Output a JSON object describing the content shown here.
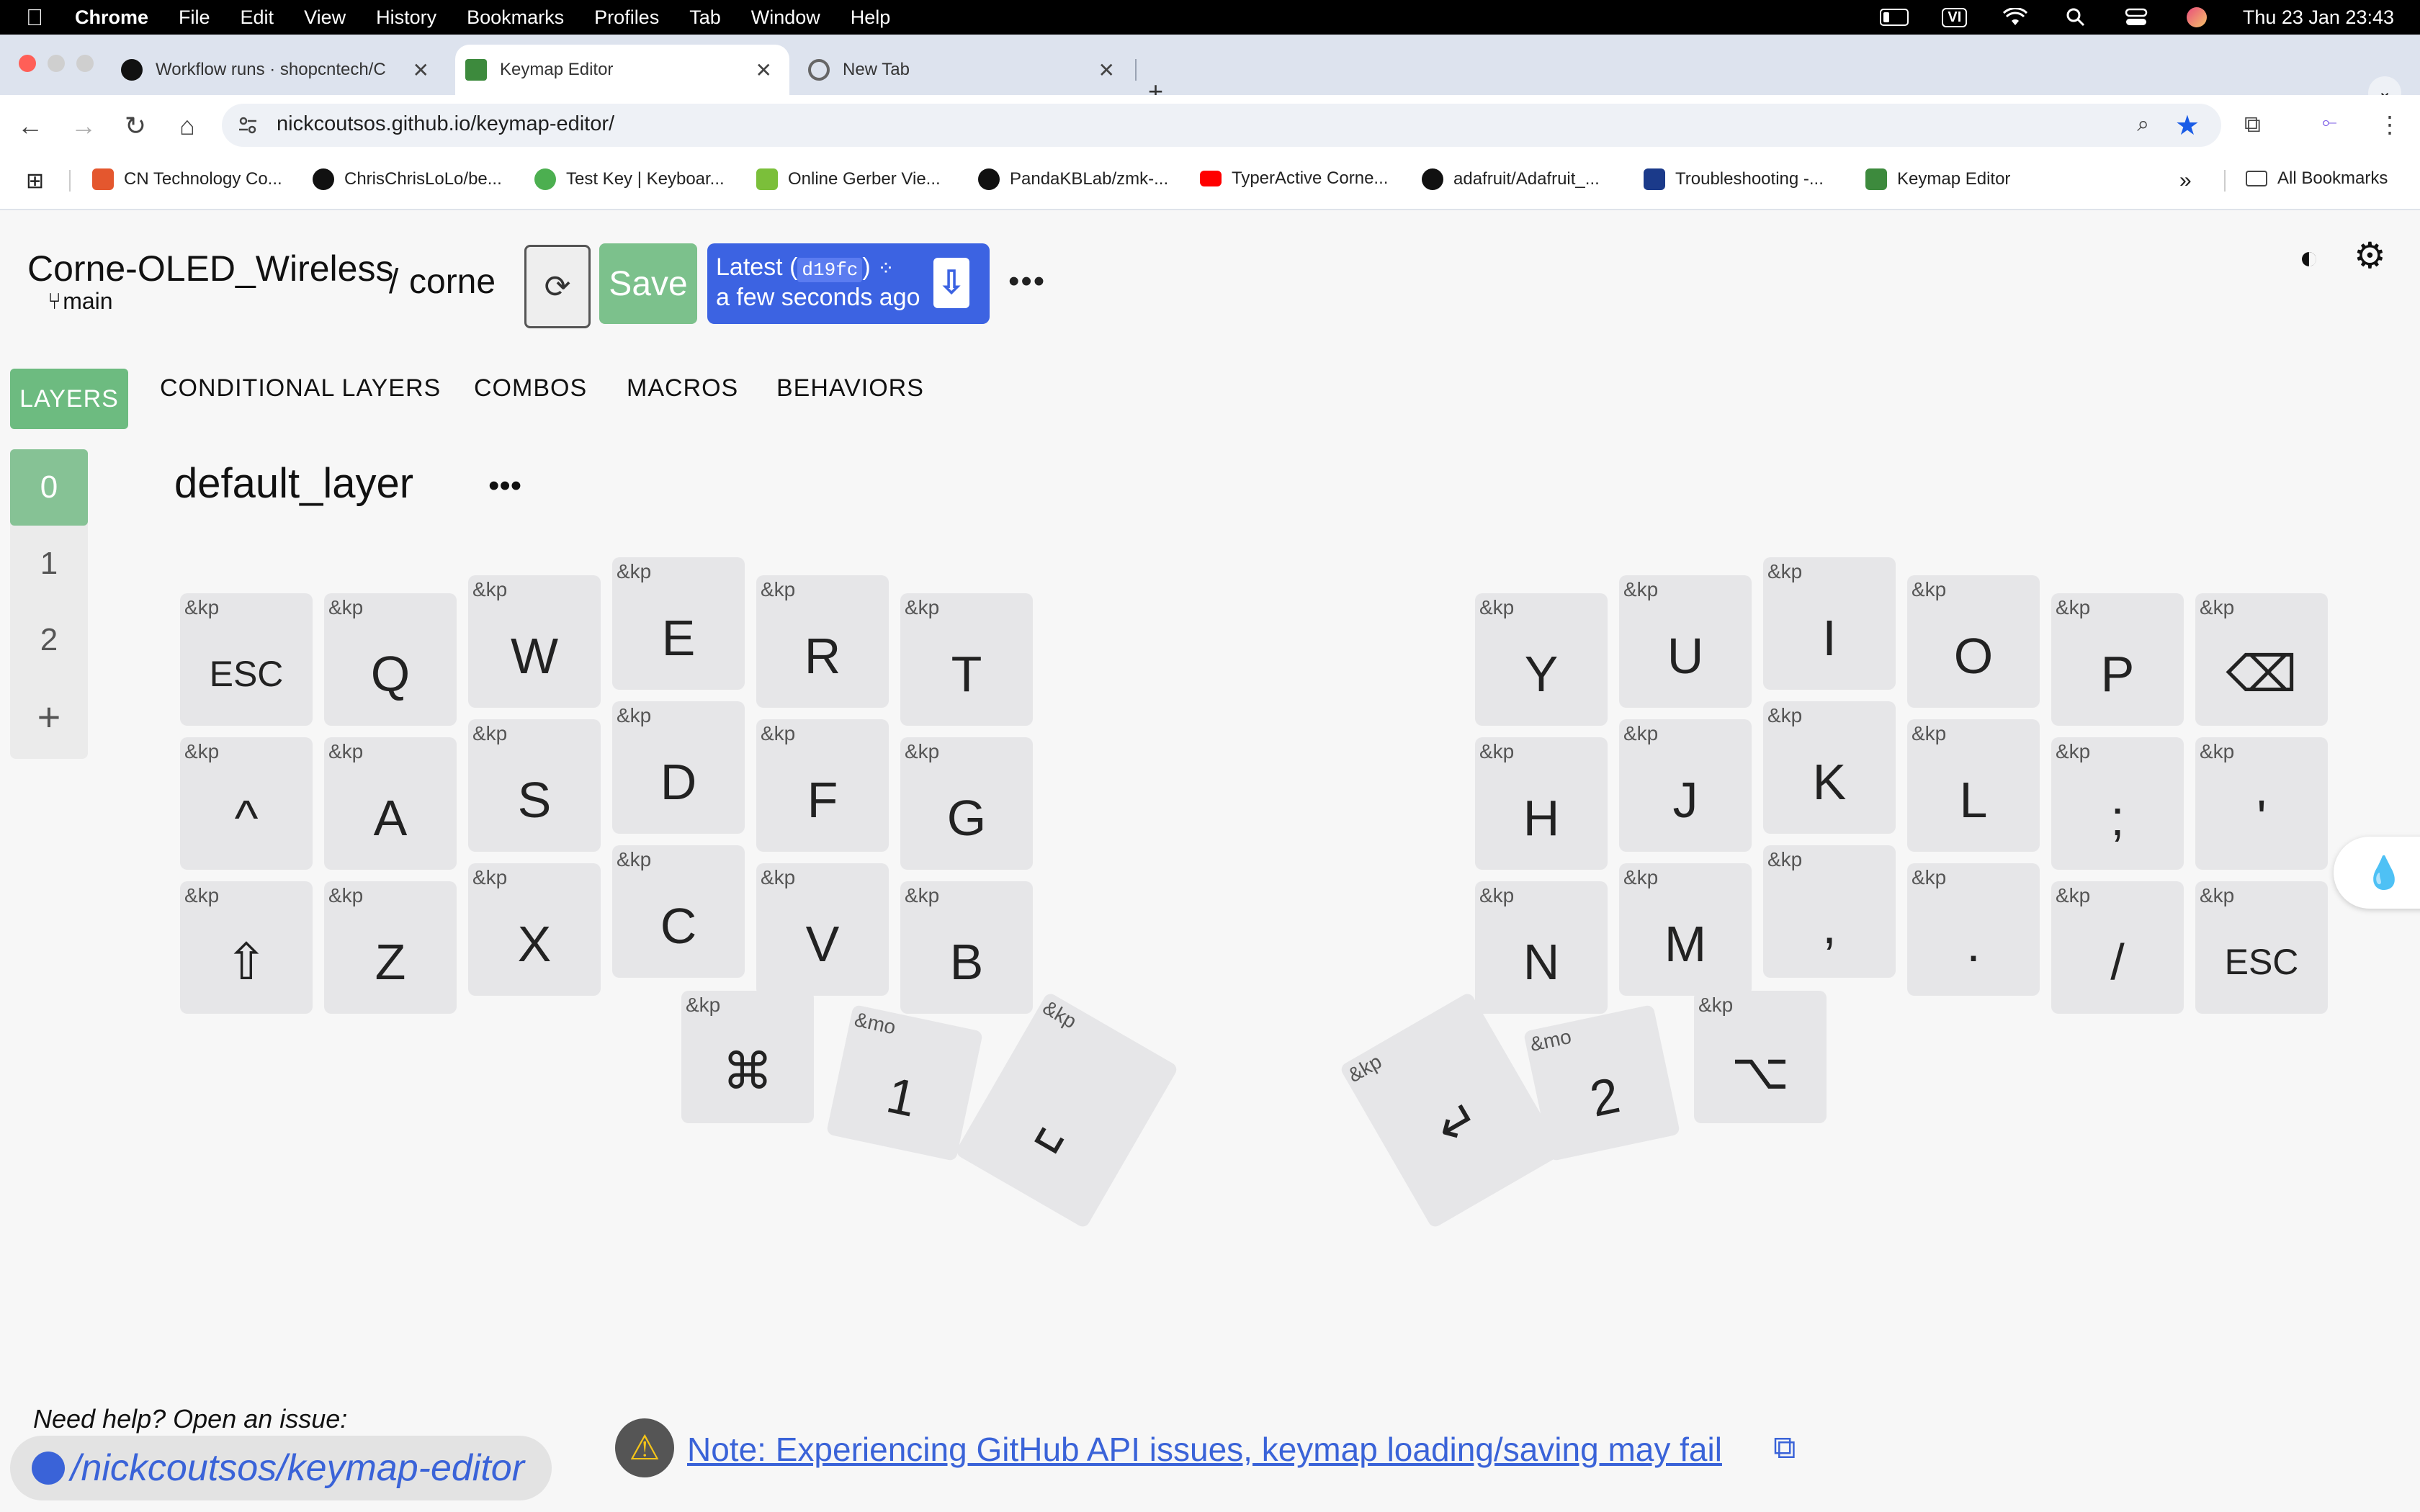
{
  "menubar": {
    "app": "Chrome",
    "items": [
      "File",
      "Edit",
      "View",
      "History",
      "Bookmarks",
      "Profiles",
      "Tab",
      "Window",
      "Help"
    ],
    "input_source": "VI",
    "clock": "Thu 23 Jan  23:43"
  },
  "tabs": [
    {
      "title": "Workflow runs · shopcntech/C",
      "icon": "github-icon"
    },
    {
      "title": "Keymap Editor",
      "icon": "keymap-editor-icon",
      "active": true
    },
    {
      "title": "New Tab",
      "icon": "chrome-icon"
    }
  ],
  "toolbar": {
    "url": "nickcoutsos.github.io/keymap-editor/"
  },
  "bookmarks": [
    {
      "label": "CN Technology Co...",
      "icon": "shop-icon",
      "color": "#e4572e"
    },
    {
      "label": "ChrisChrisLoLo/be...",
      "icon": "github-icon",
      "color": "#111111"
    },
    {
      "label": "Test Key | Keyboar...",
      "icon": "k-icon",
      "color": "#4caf50"
    },
    {
      "label": "Online Gerber Vie...",
      "icon": "gerber-icon",
      "color": "#7bbf3a"
    },
    {
      "label": "PandaKBLab/zmk-...",
      "icon": "github-icon",
      "color": "#111111"
    },
    {
      "label": "TyperActive Corne...",
      "icon": "youtube-icon",
      "color": "#ff0000"
    },
    {
      "label": "adafruit/Adafruit_...",
      "icon": "github-icon",
      "color": "#111111"
    },
    {
      "label": "Troubleshooting -...",
      "icon": "notion-icon",
      "color": "#1b3a8a"
    },
    {
      "label": "Keymap Editor",
      "icon": "keymap-editor-icon",
      "color": "#3d8a3d"
    }
  ],
  "all_bookmarks": "All Bookmarks",
  "app": {
    "repo": "Corne-OLED_Wireless",
    "separator": "/",
    "board": "corne",
    "branch": "main",
    "save_label": "Save",
    "latest_prefix": "Latest (",
    "commit": "d19fc",
    "latest_suffix": ")",
    "latest_time": "a few seconds ago",
    "accent": "#3c63e2",
    "save_color": "#7cc18c"
  },
  "section_tabs": [
    "LAYERS",
    "CONDITIONAL LAYERS",
    "COMBOS",
    "MACROS",
    "BEHAVIORS"
  ],
  "layers": [
    "0",
    "1",
    "2",
    "+"
  ],
  "layer_name": "default_layer",
  "keys": [
    {
      "b": "&kp",
      "p": "ESC"
    },
    {
      "b": "&kp",
      "p": "Q"
    },
    {
      "b": "&kp",
      "p": "W"
    },
    {
      "b": "&kp",
      "p": "E"
    },
    {
      "b": "&kp",
      "p": "R"
    },
    {
      "b": "&kp",
      "p": "T"
    },
    {
      "b": "&kp",
      "p": "Y"
    },
    {
      "b": "&kp",
      "p": "U"
    },
    {
      "b": "&kp",
      "p": "I"
    },
    {
      "b": "&kp",
      "p": "O"
    },
    {
      "b": "&kp",
      "p": "P"
    },
    {
      "b": "&kp",
      "p": "⌫"
    },
    {
      "b": "&kp",
      "p": "^"
    },
    {
      "b": "&kp",
      "p": "A"
    },
    {
      "b": "&kp",
      "p": "S"
    },
    {
      "b": "&kp",
      "p": "D"
    },
    {
      "b": "&kp",
      "p": "F"
    },
    {
      "b": "&kp",
      "p": "G"
    },
    {
      "b": "&kp",
      "p": "H"
    },
    {
      "b": "&kp",
      "p": "J"
    },
    {
      "b": "&kp",
      "p": "K"
    },
    {
      "b": "&kp",
      "p": "L"
    },
    {
      "b": "&kp",
      "p": ";"
    },
    {
      "b": "&kp",
      "p": "'"
    },
    {
      "b": "&kp",
      "p": "⇧"
    },
    {
      "b": "&kp",
      "p": "Z"
    },
    {
      "b": "&kp",
      "p": "X"
    },
    {
      "b": "&kp",
      "p": "C"
    },
    {
      "b": "&kp",
      "p": "V"
    },
    {
      "b": "&kp",
      "p": "B"
    },
    {
      "b": "&kp",
      "p": "N"
    },
    {
      "b": "&kp",
      "p": "M"
    },
    {
      "b": "&kp",
      "p": ","
    },
    {
      "b": "&kp",
      "p": "."
    },
    {
      "b": "&kp",
      "p": "/"
    },
    {
      "b": "&kp",
      "p": "ESC"
    },
    {
      "b": "&kp",
      "p": "⌘"
    },
    {
      "b": "&mo",
      "p": "1"
    },
    {
      "b": "&kp",
      "p": "␣"
    },
    {
      "b": "&kp",
      "p": "↵"
    },
    {
      "b": "&mo",
      "p": "2"
    },
    {
      "b": "&kp",
      "p": "⌥"
    }
  ],
  "footer": {
    "help": "Need help? Open an issue:",
    "repo_link": "/nickcoutsos/keymap-editor",
    "note": "Note: Experiencing GitHub API issues, keymap loading/saving may fail"
  }
}
